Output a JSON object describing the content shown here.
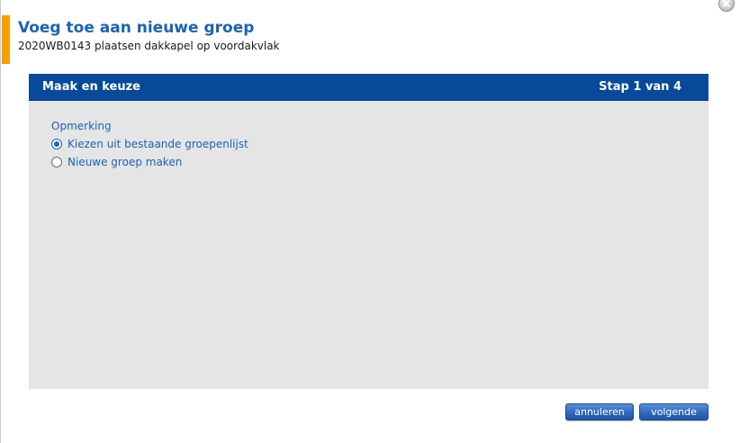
{
  "dialog": {
    "title": "Voeg toe aan nieuwe groep",
    "subtitle": "2020WB0143 plaatsen dakkapel op voordakvlak",
    "close_icon": "close-x-circle",
    "accent_color": "#f5a000"
  },
  "panel": {
    "header_title": "Maak en keuze",
    "step_text": "Stap 1 van 4",
    "header_color": "#064a99",
    "section_label": "Opmerking",
    "options": [
      {
        "label": "Kiezen uit bestaande groepenlijst",
        "selected": true
      },
      {
        "label": "Nieuwe groep maken",
        "selected": false
      }
    ]
  },
  "buttons": {
    "cancel_label": "annuleren",
    "next_label": "volgende"
  }
}
